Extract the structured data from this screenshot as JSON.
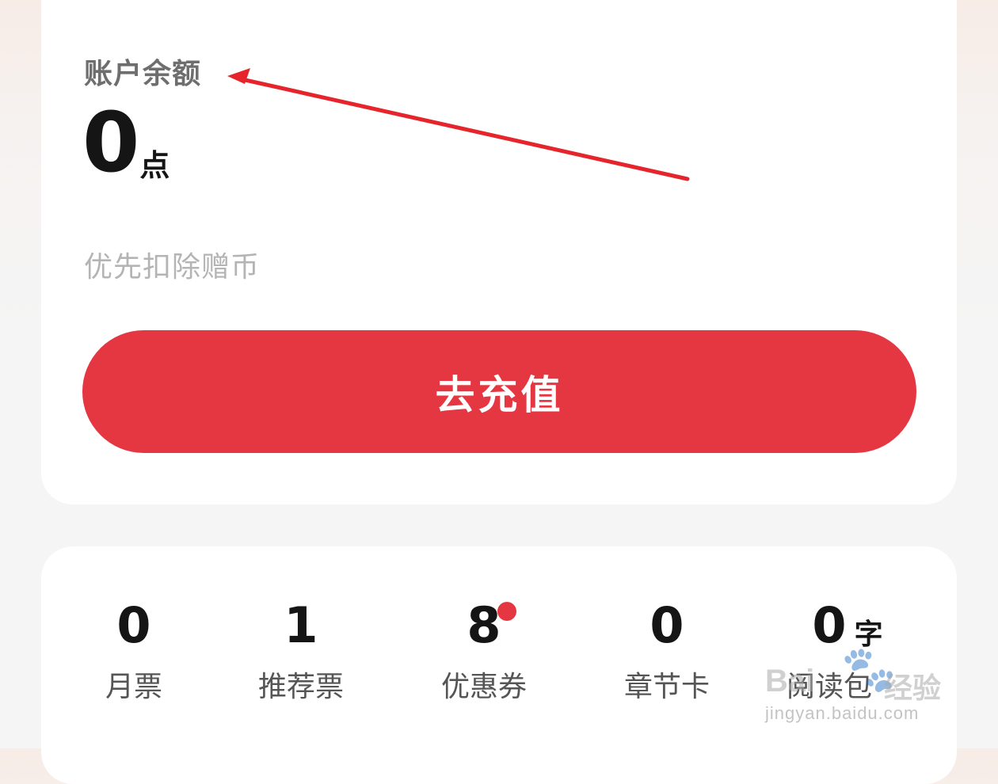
{
  "balance": {
    "label": "账户余额",
    "amount": "0",
    "unit": "点",
    "hint": "优先扣除赠币",
    "recharge_label": "去充值"
  },
  "assets": [
    {
      "count": "0",
      "label": "月票",
      "badge": false
    },
    {
      "count": "1",
      "label": "推荐票",
      "badge": false
    },
    {
      "count": "8",
      "label": "优惠券",
      "badge": true
    },
    {
      "count": "0",
      "label": "章节卡",
      "badge": false
    },
    {
      "count": "0",
      "unit": "字",
      "label": "阅读包",
      "badge": false
    }
  ],
  "watermark": {
    "brand": "Bai",
    "brand_suffix": "经验",
    "url": "jingyan.baidu.com",
    "icon": "paw-icon"
  },
  "colors": {
    "accent": "#e43742",
    "annotation_arrow": "#e5252b",
    "text_primary": "#151515",
    "text_secondary": "#6e6e6e",
    "text_hint": "#b4b4b4"
  }
}
